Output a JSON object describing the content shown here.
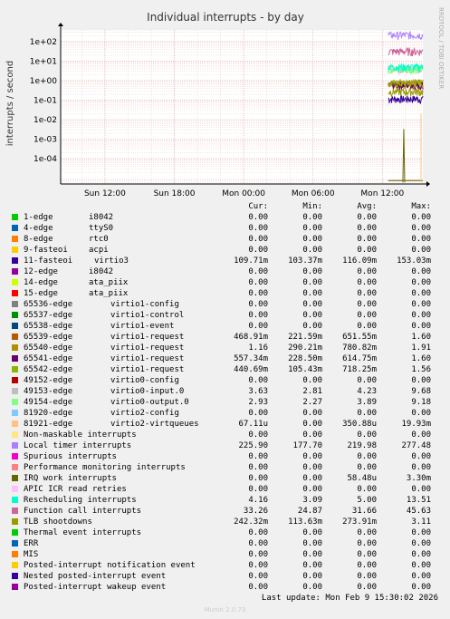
{
  "chart_data": {
    "type": "line",
    "title": "Individual interrupts - by day",
    "ylabel": "interrupts / second",
    "yscale": "log",
    "ylim": [
      5e-06,
      400
    ],
    "yticks": [
      {
        "v": 100,
        "label": "1e+02"
      },
      {
        "v": 10,
        "label": "1e+01"
      },
      {
        "v": 1,
        "label": "1e+00"
      },
      {
        "v": 0.1,
        "label": "1e-01"
      },
      {
        "v": 0.01,
        "label": "1e-02"
      },
      {
        "v": 0.001,
        "label": "1e-03"
      },
      {
        "v": 0.0001,
        "label": "1e-04"
      }
    ],
    "xlim": [
      "Sun 08:10",
      "Mon 15:30"
    ],
    "xticks": [
      "Sun 12:00",
      "Sun 18:00",
      "Mon 00:00",
      "Mon 06:00",
      "Mon 12:00"
    ],
    "grid": true,
    "data_start": "Mon 12:30"
  },
  "side_text": "RRDTOOL / TOBI OETIKER",
  "legend_headers": {
    "cur": "Cur:",
    "min": "Min:",
    "avg": "Avg:",
    "max": "Max:"
  },
  "series": [
    {
      "name": "1-edge",
      "desc": "i8042",
      "cur": "0.00",
      "min": "0.00",
      "avg": "0.00",
      "max": "0.00",
      "color": "#00cc00",
      "level": 0
    },
    {
      "name": "4-edge",
      "desc": "ttyS0",
      "cur": "0.00",
      "min": "0.00",
      "avg": "0.00",
      "max": "0.00",
      "color": "#0066b3",
      "level": 0
    },
    {
      "name": "8-edge",
      "desc": "rtc0",
      "cur": "0.00",
      "min": "0.00",
      "avg": "0.00",
      "max": "0.00",
      "color": "#ff8000",
      "level": 0
    },
    {
      "name": "9-fasteoi",
      "desc": "acpi",
      "cur": "0.00",
      "min": "0.00",
      "avg": "0.00",
      "max": "0.00",
      "color": "#ffcc00",
      "level": 0
    },
    {
      "name": "11-fasteoi",
      "desc": "virtio3",
      "cur": "109.71m",
      "min": "103.37m",
      "avg": "116.09m",
      "max": "153.03m",
      "color": "#330099",
      "level": 0.116
    },
    {
      "name": "12-edge",
      "desc": "i8042",
      "cur": "0.00",
      "min": "0.00",
      "avg": "0.00",
      "max": "0.00",
      "color": "#990099",
      "level": 0
    },
    {
      "name": "14-edge",
      "desc": "ata_piix",
      "cur": "0.00",
      "min": "0.00",
      "avg": "0.00",
      "max": "0.00",
      "color": "#ccff00",
      "level": 0
    },
    {
      "name": "15-edge",
      "desc": "ata_piix",
      "cur": "0.00",
      "min": "0.00",
      "avg": "0.00",
      "max": "0.00",
      "color": "#ff0000",
      "level": 0
    },
    {
      "name": "65536-edge",
      "desc": "virtio1-config",
      "cur": "0.00",
      "min": "0.00",
      "avg": "0.00",
      "max": "0.00",
      "color": "#808080",
      "level": 0
    },
    {
      "name": "65537-edge",
      "desc": "virtio1-control",
      "cur": "0.00",
      "min": "0.00",
      "avg": "0.00",
      "max": "0.00",
      "color": "#008f00",
      "level": 0
    },
    {
      "name": "65538-edge",
      "desc": "virtio1-event",
      "cur": "0.00",
      "min": "0.00",
      "avg": "0.00",
      "max": "0.00",
      "color": "#00487d",
      "level": 0
    },
    {
      "name": "65539-edge",
      "desc": "virtio1-request",
      "cur": "468.91m",
      "min": "221.59m",
      "avg": "651.55m",
      "max": "1.60",
      "color": "#b35a00",
      "level": 0.65
    },
    {
      "name": "65540-edge",
      "desc": "virtio1-request",
      "cur": "1.16",
      "min": "290.21m",
      "avg": "780.82m",
      "max": "1.91",
      "color": "#b38f00",
      "level": 0.78
    },
    {
      "name": "65541-edge",
      "desc": "virtio1-request",
      "cur": "557.34m",
      "min": "228.50m",
      "avg": "614.75m",
      "max": "1.60",
      "color": "#6b006b",
      "level": 0.61
    },
    {
      "name": "65542-edge",
      "desc": "virtio1-request",
      "cur": "440.69m",
      "min": "105.43m",
      "avg": "718.25m",
      "max": "1.56",
      "color": "#8fb300",
      "level": 0.72
    },
    {
      "name": "49152-edge",
      "desc": "virtio0-config",
      "cur": "0.00",
      "min": "0.00",
      "avg": "0.00",
      "max": "0.00",
      "color": "#b30000",
      "level": 0
    },
    {
      "name": "49153-edge",
      "desc": "virtio0-input.0",
      "cur": "3.63",
      "min": "2.81",
      "avg": "4.23",
      "max": "9.68",
      "color": "#bebebe",
      "level": 4.23
    },
    {
      "name": "49154-edge",
      "desc": "virtio0-output.0",
      "cur": "2.93",
      "min": "2.27",
      "avg": "3.89",
      "max": "9.18",
      "color": "#80ff80",
      "level": 3.89
    },
    {
      "name": "81920-edge",
      "desc": "virtio2-config",
      "cur": "0.00",
      "min": "0.00",
      "avg": "0.00",
      "max": "0.00",
      "color": "#80c9ff",
      "level": 0
    },
    {
      "name": "81921-edge",
      "desc": "virtio2-virtqueues",
      "cur": "67.11u",
      "min": "0.00",
      "avg": "350.88u",
      "max": "19.93m",
      "color": "#ffc080",
      "level": 0.00035
    },
    {
      "name": "Non-maskable interrupts",
      "desc": "",
      "cur": "0.00",
      "min": "0.00",
      "avg": "0.00",
      "max": "0.00",
      "color": "#ffe680",
      "level": 0
    },
    {
      "name": "Local timer interrupts",
      "desc": "",
      "cur": "225.90",
      "min": "177.70",
      "avg": "219.98",
      "max": "277.48",
      "color": "#aa80ff",
      "level": 219.98
    },
    {
      "name": "Spurious interrupts",
      "desc": "",
      "cur": "0.00",
      "min": "0.00",
      "avg": "0.00",
      "max": "0.00",
      "color": "#ee00cc",
      "level": 0
    },
    {
      "name": "Performance monitoring interrupts",
      "desc": "",
      "cur": "0.00",
      "min": "0.00",
      "avg": "0.00",
      "max": "0.00",
      "color": "#ff8080",
      "level": 0
    },
    {
      "name": "IRQ work interrupts",
      "desc": "",
      "cur": "0.00",
      "min": "0.00",
      "avg": "58.48u",
      "max": "3.30m",
      "color": "#666600",
      "level": 6e-05
    },
    {
      "name": "APIC ICR read retries",
      "desc": "",
      "cur": "0.00",
      "min": "0.00",
      "avg": "0.00",
      "max": "0.00",
      "color": "#ffbfff",
      "level": 0
    },
    {
      "name": "Rescheduling interrupts",
      "desc": "",
      "cur": "4.16",
      "min": "3.09",
      "avg": "5.00",
      "max": "13.51",
      "color": "#00ffcc",
      "level": 5.0
    },
    {
      "name": "Function call interrupts",
      "desc": "",
      "cur": "33.26",
      "min": "24.87",
      "avg": "31.66",
      "max": "45.63",
      "color": "#cc6699",
      "level": 31.66
    },
    {
      "name": "TLB shootdowns",
      "desc": "",
      "cur": "242.32m",
      "min": "113.63m",
      "avg": "273.91m",
      "max": "3.11",
      "color": "#999900",
      "level": 0.274
    },
    {
      "name": "Thermal event interrupts",
      "desc": "",
      "cur": "0.00",
      "min": "0.00",
      "avg": "0.00",
      "max": "0.00",
      "color": "#00cc00",
      "level": 0
    },
    {
      "name": "ERR",
      "desc": "",
      "cur": "0.00",
      "min": "0.00",
      "avg": "0.00",
      "max": "0.00",
      "color": "#0066b3",
      "level": 0
    },
    {
      "name": "MIS",
      "desc": "",
      "cur": "0.00",
      "min": "0.00",
      "avg": "0.00",
      "max": "0.00",
      "color": "#ff8000",
      "level": 0
    },
    {
      "name": "Posted-interrupt notification event",
      "desc": "",
      "cur": "0.00",
      "min": "0.00",
      "avg": "0.00",
      "max": "0.00",
      "color": "#ffcc00",
      "level": 0
    },
    {
      "name": "Nested posted-interrupt event",
      "desc": "",
      "cur": "0.00",
      "min": "0.00",
      "avg": "0.00",
      "max": "0.00",
      "color": "#330099",
      "level": 0
    },
    {
      "name": "Posted-interrupt wakeup event",
      "desc": "",
      "cur": "0.00",
      "min": "0.00",
      "avg": "0.00",
      "max": "0.00",
      "color": "#990099",
      "level": 0
    }
  ],
  "footer": {
    "last_update": "Last update: Mon Feb  9 15:30:02 2026",
    "version": "Munin 2.0.73"
  }
}
